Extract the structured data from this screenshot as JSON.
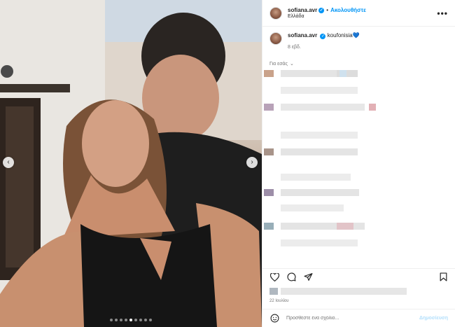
{
  "post": {
    "username": "sofiana.avr",
    "separator": "•",
    "follow_label": "Ακολουθήστε",
    "location": "Ελλάδα",
    "more_label": "•••"
  },
  "caption": {
    "username": "sofiana.avr",
    "text": "koufonisia",
    "emoji": "💙",
    "time": "8 εβδ."
  },
  "comments_filter": "Για εσάς",
  "footer": {
    "date": "22 Ιουλίου",
    "comment_placeholder": "Προσθέστε ένα σχόλιο...",
    "post_label": "Δημοσίευση"
  },
  "carousel": {
    "slides": 9,
    "active_index": 4
  },
  "colors": {
    "accent": "#0095f6",
    "verified": "#0095f6",
    "border": "#efefef"
  },
  "icons": [
    "verified-badge-icon",
    "more-options-icon",
    "heart-icon",
    "comment-icon",
    "share-icon",
    "bookmark-icon",
    "emoji-icon",
    "chevron-left-icon",
    "chevron-right-icon",
    "chevron-down-icon"
  ]
}
